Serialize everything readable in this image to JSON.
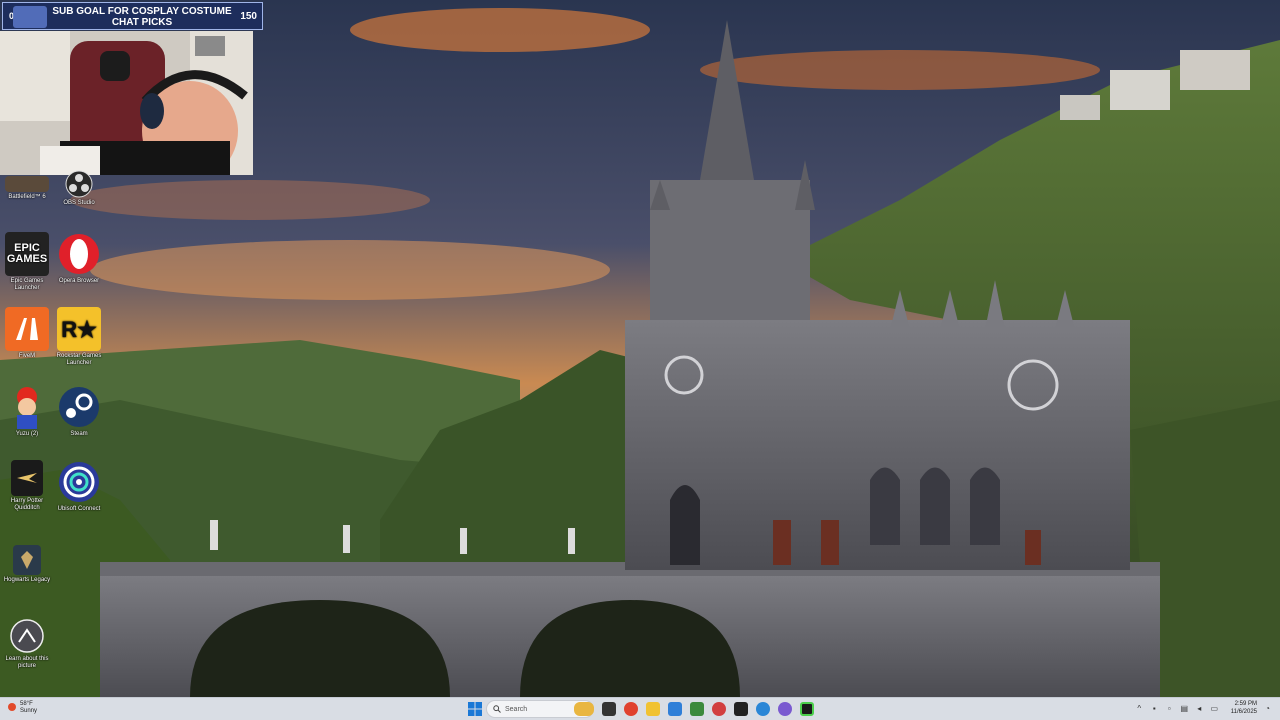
{
  "overlay": {
    "subgoal_start": "0",
    "subgoal_text": "SUB GOAL FOR COSPLAY COSTUME CHAT PICKS",
    "subgoal_end": "150"
  },
  "desktop_icons": [
    {
      "label": "Battlefield™ 6",
      "icon": "battlefield-icon"
    },
    {
      "label": "OBS Studio",
      "icon": "obs-icon"
    },
    {
      "label": "Epic Games Launcher",
      "icon": "epic-games-icon"
    },
    {
      "label": "Opera Browser",
      "icon": "opera-icon"
    },
    {
      "label": "FiveM",
      "icon": "fivem-icon"
    },
    {
      "label": "Rockstar Games Launcher",
      "icon": "rockstar-icon"
    },
    {
      "label": "Yuzu (2)",
      "icon": "mario-icon"
    },
    {
      "label": "Steam",
      "icon": "steam-icon"
    },
    {
      "label": "Harry Potter Quidditch",
      "icon": "quidditch-icon"
    },
    {
      "label": "Ubisoft Connect",
      "icon": "ubisoft-icon"
    },
    {
      "label": "Hogwarts Legacy",
      "icon": "hogwarts-icon"
    },
    {
      "label": "Learn about this picture",
      "icon": "learn-picture-icon"
    }
  ],
  "taskbar": {
    "weather_temp": "58°F",
    "weather_desc": "Sunny",
    "search_placeholder": "Search",
    "time": "2:59 PM",
    "date": "11/6/2025"
  },
  "colors": {
    "taskbar_bg": "#d9dde4",
    "subgoal_bg": "#1d2d5c"
  }
}
